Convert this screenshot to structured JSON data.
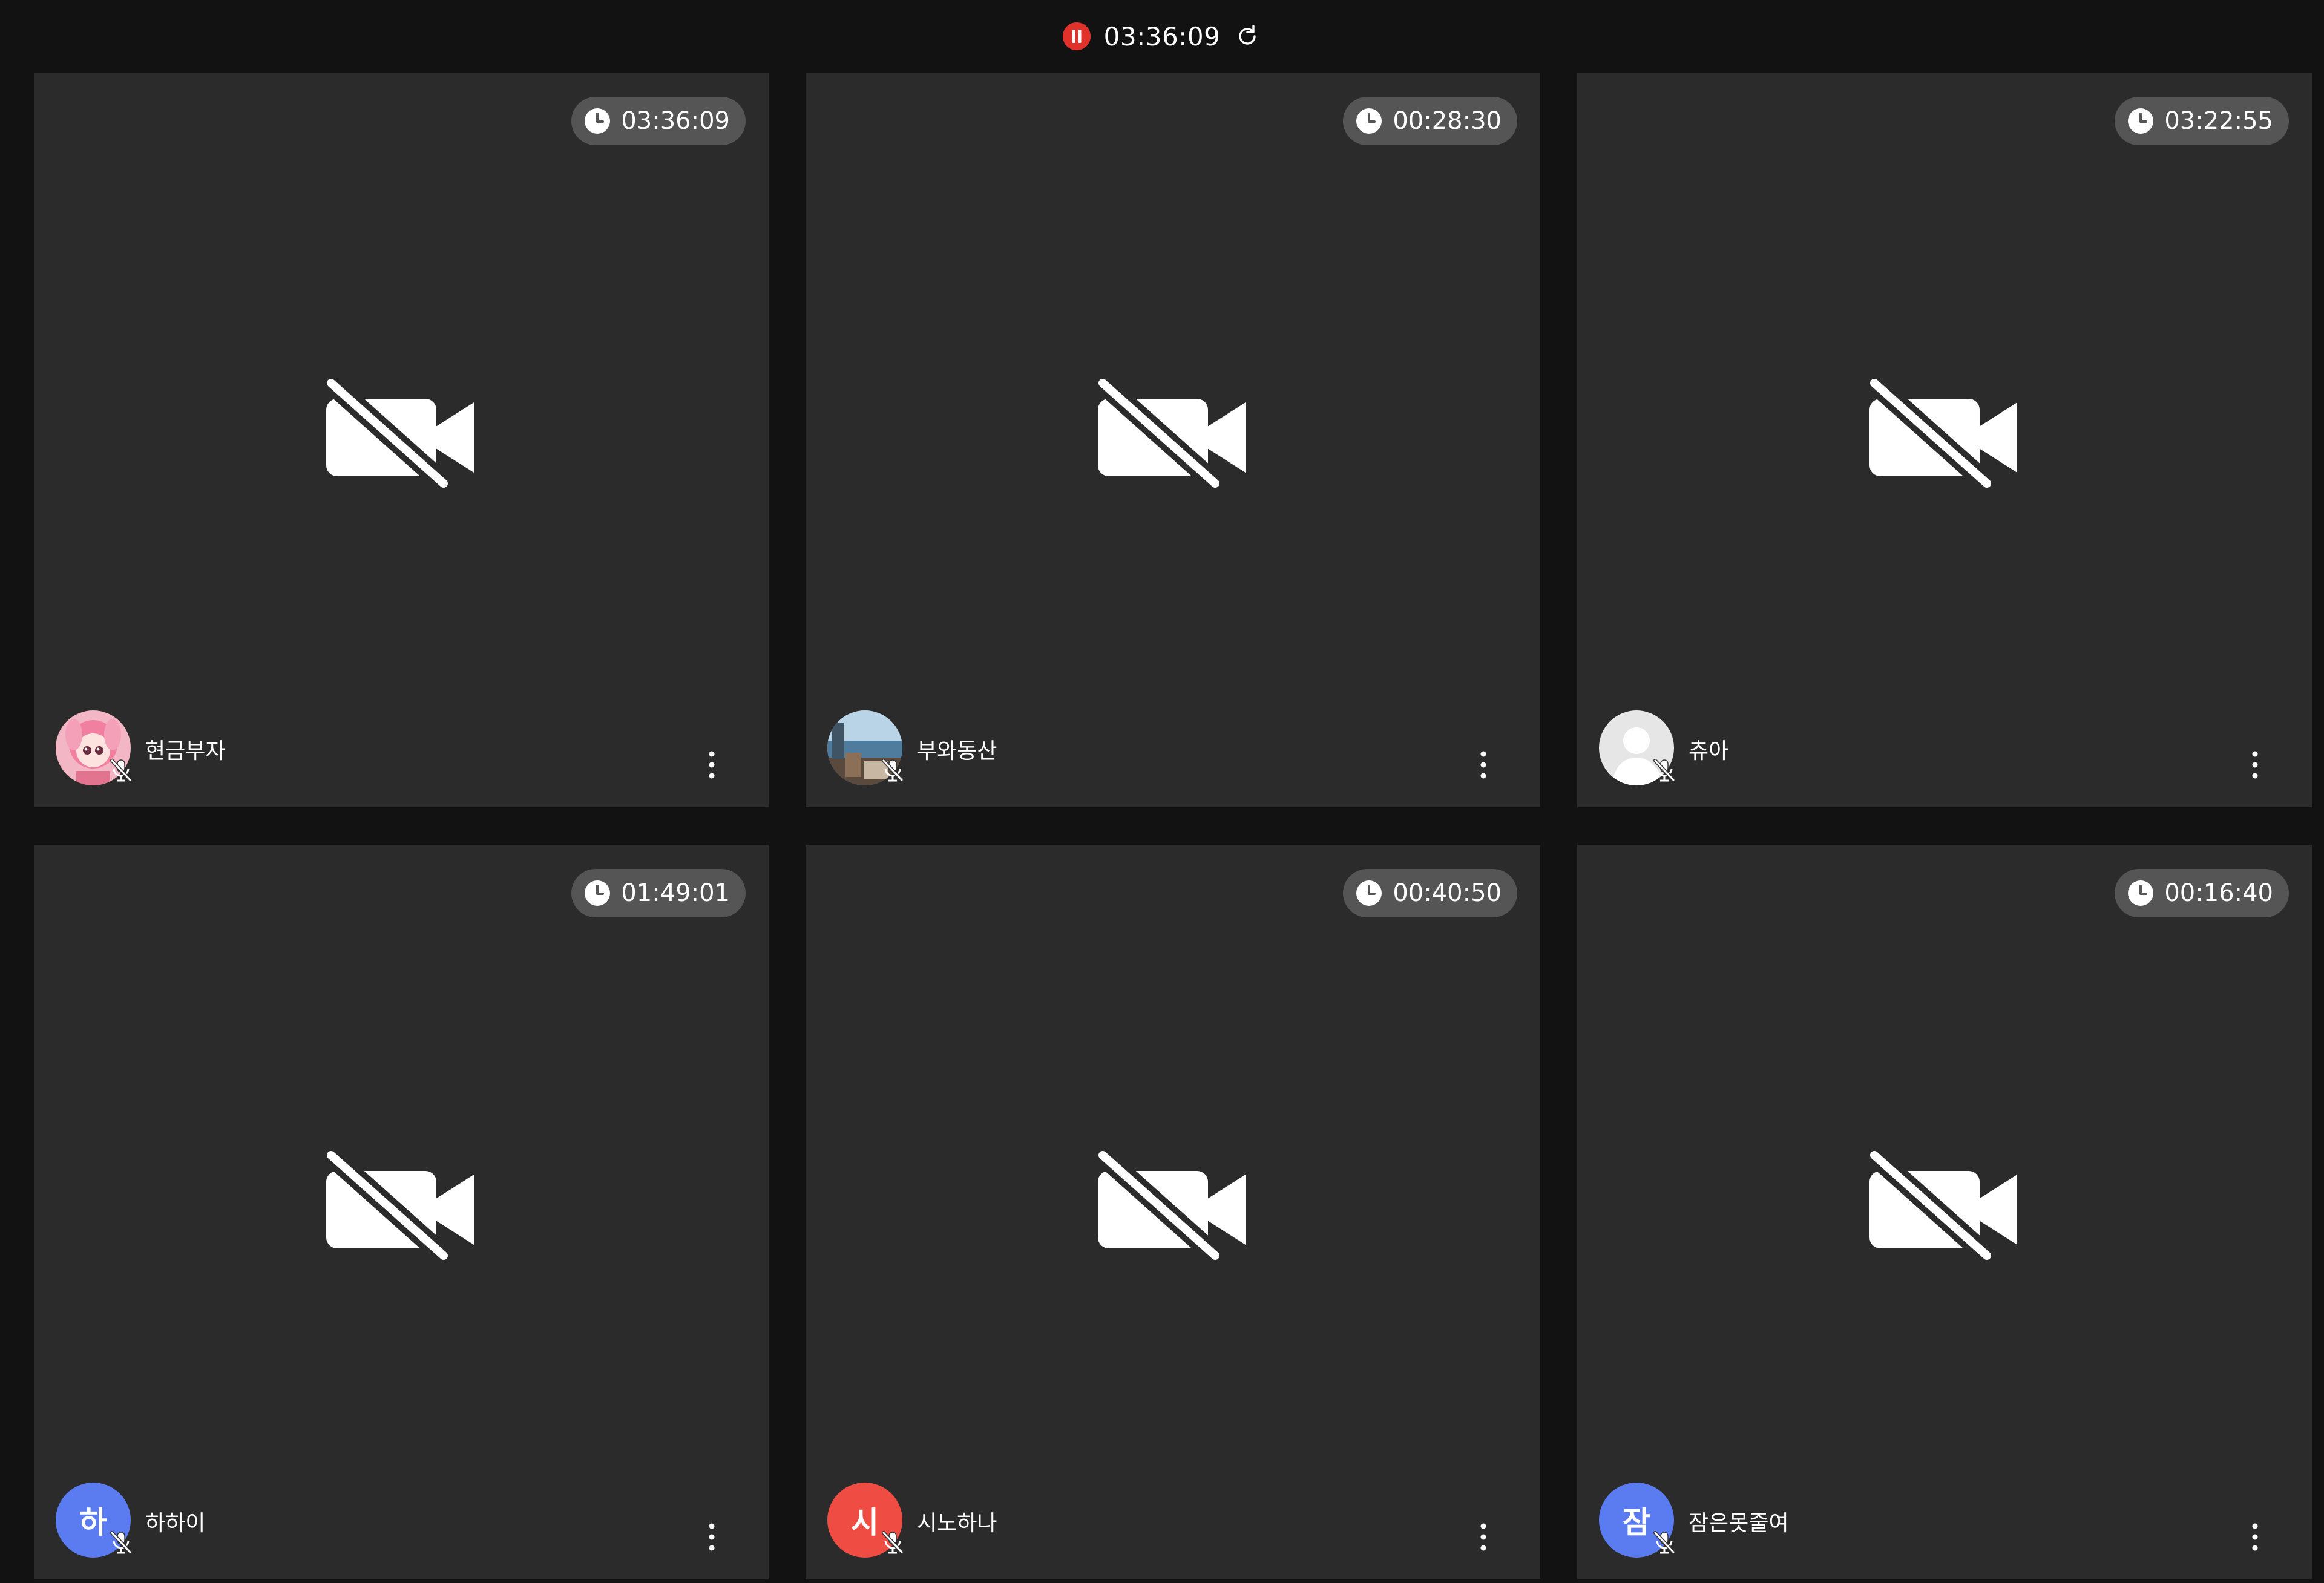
{
  "session": {
    "recording_status": "recording-paused",
    "elapsed": "03:36:09",
    "rec_color": "#e0312b"
  },
  "participants": [
    {
      "name": "현금부자",
      "timer": "03:36:09",
      "avatar": "photo-pink-doll",
      "camera": "off",
      "mic": "muted"
    },
    {
      "name": "부와동산",
      "timer": "00:28:30",
      "avatar": "photo-landscape",
      "camera": "off",
      "mic": "muted"
    },
    {
      "name": "츄아",
      "timer": "03:22:55",
      "avatar": "default-silhouette",
      "camera": "off",
      "mic": "muted"
    },
    {
      "name": "하하이",
      "timer": "01:49:01",
      "avatar": "letter",
      "avatar_letter": "하",
      "avatar_color": "#5b7cf0",
      "camera": "off",
      "mic": "muted"
    },
    {
      "name": "시노하나",
      "timer": "00:40:50",
      "avatar": "letter",
      "avatar_letter": "시",
      "avatar_color": "#ef4d43",
      "camera": "off",
      "mic": "muted"
    },
    {
      "name": "잠은못줄여",
      "timer": "00:16:40",
      "avatar": "letter",
      "avatar_letter": "잠",
      "avatar_color": "#5b7cf0",
      "camera": "off",
      "mic": "muted"
    }
  ],
  "icons": {
    "timer": "clock-icon",
    "camera_off": "video-off-icon",
    "mic_off": "mic-off-icon",
    "more": "more-vertical-icon",
    "refresh": "refresh-icon",
    "recording": "pause-circle-icon"
  }
}
